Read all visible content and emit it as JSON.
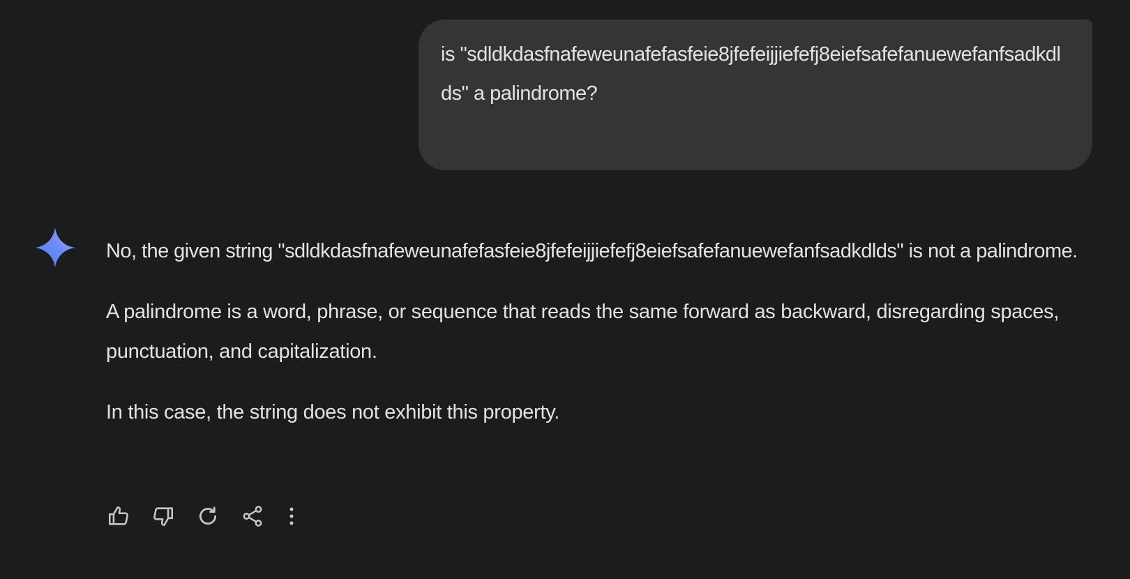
{
  "user_message": {
    "text": "is \"sdldkdasfnafeweunafefasfeie8jfefeijjiefefj8eiefsafefanuewefanfsadkdlds\" a palindrome?"
  },
  "response": {
    "paragraphs": [
      "No, the given string \"sdldkdasfnafeweunafefasfeie8jfefeijjiefefj8eiefsafefanuewefanfsadkdlds\" is not a palindrome.",
      "A palindrome is a word, phrase, or sequence that reads the same forward as backward, disregarding spaces, punctuation, and capitalization.",
      "In this case, the string does not exhibit this property."
    ]
  },
  "actions": [
    {
      "icon": "thumbs-up-icon"
    },
    {
      "icon": "thumbs-down-icon"
    },
    {
      "icon": "regenerate-icon"
    },
    {
      "icon": "share-icon"
    },
    {
      "icon": "more-options-icon"
    }
  ],
  "colors": {
    "background": "#1b1c1e",
    "user_bubble": "#333537",
    "text": "#e3e3e3",
    "icon": "#c4c7c5",
    "sparkle_start": "#4f8df5",
    "sparkle_end": "#a98ef7"
  }
}
